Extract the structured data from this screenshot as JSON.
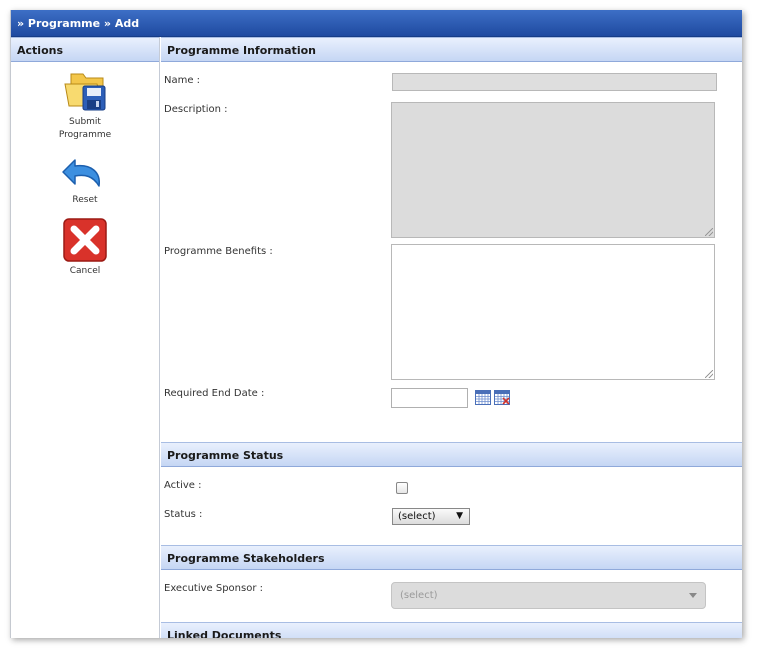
{
  "window": {
    "title": "» Programme » Add"
  },
  "sidebar": {
    "header": "Actions",
    "actions": [
      {
        "label_line1": "Submit",
        "label_line2": "Programme",
        "icon": "folder-save-icon"
      },
      {
        "label": "Reset",
        "icon": "undo-arrow-icon"
      },
      {
        "label": "Cancel",
        "icon": "red-x-icon"
      }
    ]
  },
  "sections": {
    "info": {
      "header": "Programme Information",
      "name_label": "Name :",
      "name_value": "",
      "description_label": "Description :",
      "description_value": "",
      "benefits_label": "Programme Benefits :",
      "benefits_value": "",
      "end_date_label": "Required End Date :",
      "end_date_value": ""
    },
    "status": {
      "header": "Programme Status",
      "active_label": "Active :",
      "status_label": "Status :",
      "status_value": "(select)"
    },
    "stakeholders": {
      "header": "Programme Stakeholders",
      "sponsor_label": "Executive Sponsor :",
      "sponsor_value": "(select)"
    },
    "documents": {
      "header": "Linked Documents"
    }
  },
  "colors": {
    "titlebar": "#2a57ad",
    "section_head": "#c5d6f4"
  }
}
